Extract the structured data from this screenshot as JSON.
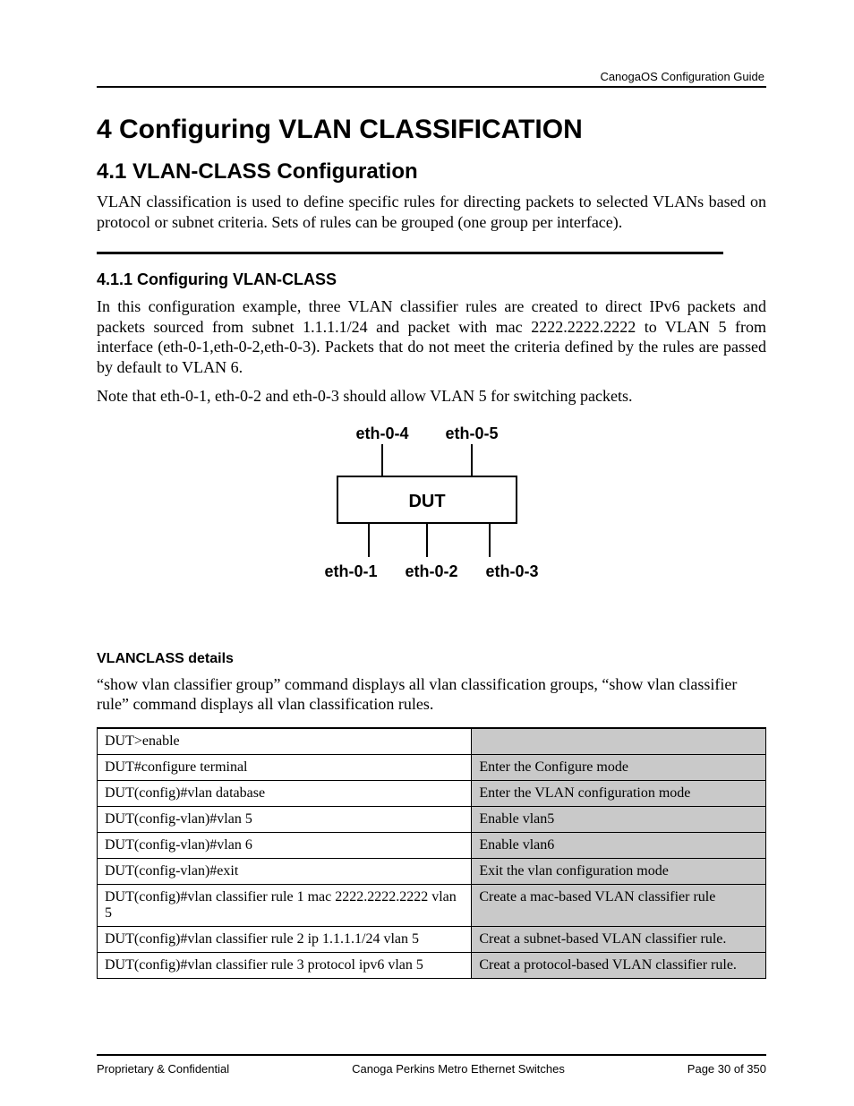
{
  "header": {
    "doc_title": "CanogaOS Configuration Guide"
  },
  "chapter": {
    "title": "4  Configuring VLAN CLASSIFICATION"
  },
  "section": {
    "title": "4.1 VLAN-CLASS Configuration",
    "intro": "VLAN classification is used to define specific rules for directing packets to selected VLANs based on protocol or subnet criteria. Sets of rules can be grouped (one group per interface)."
  },
  "subsection": {
    "title": "4.1.1  Configuring VLAN-CLASS",
    "para1": "In this configuration example, three VLAN classifier rules are created to direct IPv6 packets and packets sourced from subnet 1.1.1.1/24 and packet with mac 2222.2222.2222 to VLAN 5 from interface (eth-0-1,eth-0-2,eth-0-3). Packets that do not meet the criteria defined by the rules are passed by default to VLAN 6.",
    "para2": "Note that eth-0-1, eth-0-2 and eth-0-3 should allow VLAN 5 for switching packets."
  },
  "diagram": {
    "labels": {
      "top_l": "eth-0-4",
      "top_r": "eth-0-5",
      "box": "DUT",
      "bot_l": "eth-0-1",
      "bot_m": "eth-0-2",
      "bot_r": "eth-0-3"
    }
  },
  "details": {
    "heading": "VLANCLASS details",
    "para": "“show vlan classifier group” command displays all vlan classification groups, “show vlan classifier rule” command displays all vlan classification rules."
  },
  "table": {
    "rows": [
      {
        "cmd": "DUT>enable",
        "desc": ""
      },
      {
        "cmd": "DUT#configure terminal",
        "desc": "Enter the Configure mode"
      },
      {
        "cmd": "DUT(config)#vlan database",
        "desc": "Enter the VLAN configuration mode"
      },
      {
        "cmd": "DUT(config-vlan)#vlan 5",
        "desc": "Enable vlan5"
      },
      {
        "cmd": "DUT(config-vlan)#vlan 6",
        "desc": "Enable vlan6"
      },
      {
        "cmd": "DUT(config-vlan)#exit",
        "desc": "Exit the vlan configuration mode"
      },
      {
        "cmd": "DUT(config)#vlan classifier rule 1 mac 2222.2222.2222 vlan 5",
        "desc": "Create a mac-based VLAN classifier rule"
      },
      {
        "cmd": "DUT(config)#vlan classifier rule 2 ip 1.1.1.1/24 vlan 5",
        "desc": "Creat a subnet-based VLAN classifier rule."
      },
      {
        "cmd": "DUT(config)#vlan classifier rule 3 protocol ipv6 vlan 5",
        "desc": "Creat a protocol-based VLAN classifier rule."
      }
    ]
  },
  "footer": {
    "left": "Proprietary & Confidential",
    "center": "Canoga Perkins Metro Ethernet Switches",
    "right": "Page 30 of 350"
  }
}
